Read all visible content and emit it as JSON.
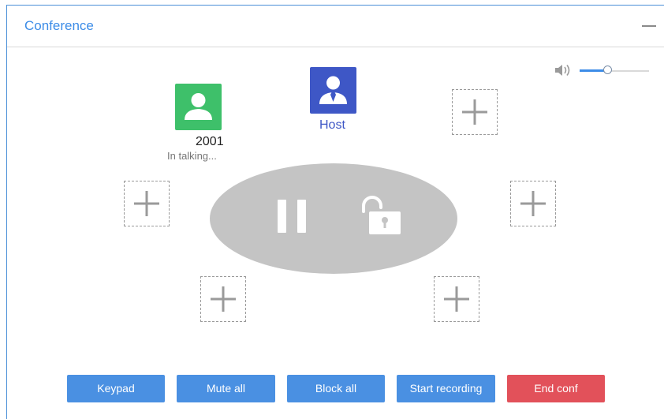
{
  "panel": {
    "title": "Conference"
  },
  "volume": {
    "level_percent": 40
  },
  "members": [
    {
      "number": "2001",
      "status": "In talking...",
      "color": "#3ec06a"
    }
  ],
  "host": {
    "label": "Host",
    "color": "#3e57c6"
  },
  "controls": {
    "pause_icon": "pause-icon",
    "lock_icon": "unlock-icon"
  },
  "buttons": {
    "keypad": "Keypad",
    "mute_all": "Mute all",
    "block_all": "Block all",
    "start_recording": "Start recording",
    "end_conf": "End conf"
  },
  "colors": {
    "accent": "#3c8ce7",
    "button_blue": "#4a90e2",
    "button_red": "#e2515a",
    "oval": "#c4c4c4"
  }
}
